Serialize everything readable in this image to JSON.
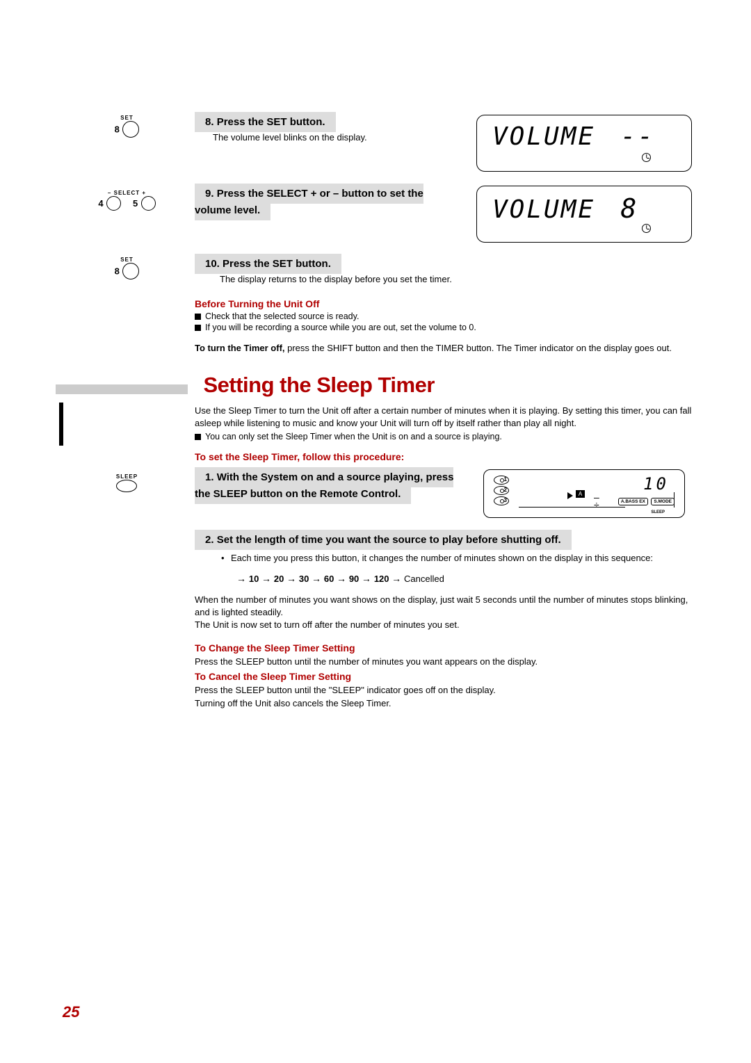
{
  "buttons": {
    "set_label": "SET",
    "set_num": "8",
    "select_label": "SELECT",
    "select_minus": "–",
    "select_plus": "+",
    "select_num_left": "4",
    "select_num_right": "5",
    "sleep_label": "SLEEP"
  },
  "step8": {
    "num": "8.",
    "title": "Press the SET button.",
    "body": "The volume level blinks on the display."
  },
  "step9": {
    "num": "9.",
    "title": "Press the SELECT + or – button to set the volume level."
  },
  "step10": {
    "num": "10.",
    "title": "Press the SET button.",
    "body": "The display returns to the display before you set the timer."
  },
  "display1": {
    "text": "VOLUME",
    "suffix": "--"
  },
  "display2": {
    "text": "VOLUME",
    "suffix": "8"
  },
  "before_off": {
    "heading": "Before Turning the Unit Off",
    "b1": "Check that the selected source is ready.",
    "b2": "If you will be recording a source while you are out, set the volume to 0."
  },
  "timer_off": {
    "bold": "To turn the Timer off,",
    "rest": " press the SHIFT button and then the TIMER button. The Timer indicator on the display goes out."
  },
  "section_title": "Setting the Sleep Timer",
  "intro": {
    "p": "Use the Sleep Timer to turn the Unit off after a certain number of minutes when it is playing. By setting this timer, you can fall asleep while listening to music and know your Unit will turn off by itself rather than play all night.",
    "bullet": "You can only set the Sleep Timer when the Unit is on and a source is playing."
  },
  "procedure_title": "To set the Sleep Timer, follow this procedure:",
  "sleep_step1": {
    "num": "1.",
    "title": "With the System on and a source playing, press the SLEEP button on the Remote Control."
  },
  "sleep_display": {
    "value": "10",
    "block": "A",
    "badge1": "A.BASS EX",
    "badge2": "S.MODE",
    "sleep_lbl": "SLEEP",
    "d1": "1",
    "d2": "2",
    "d3": "3"
  },
  "sleep_step2": {
    "num": "2.",
    "title": "Set the length of time you want the source to play before shutting off.",
    "bullet": "Each time you press this button, it changes the number of minutes shown on the display in this sequence:",
    "seq_vals": [
      "10",
      "20",
      "30",
      "60",
      "90",
      "120"
    ],
    "seq_end": "Cancelled"
  },
  "closing": {
    "p1": "When the number of minutes you want shows on the display, just wait 5 seconds until the number of minutes stops blinking, and is lighted steadily.",
    "p2": "The Unit is now set to turn off after the number of minutes you set."
  },
  "change": {
    "heading": "To Change the Sleep Timer Setting",
    "body": "Press the SLEEP button until the number of minutes you want appears on the display."
  },
  "cancel": {
    "heading": "To Cancel the Sleep Timer Setting",
    "body1": "Press the SLEEP button until the \"SLEEP\" indicator goes off on the display.",
    "body2": "Turning off the Unit also cancels the Sleep Timer."
  },
  "page_number": "25"
}
